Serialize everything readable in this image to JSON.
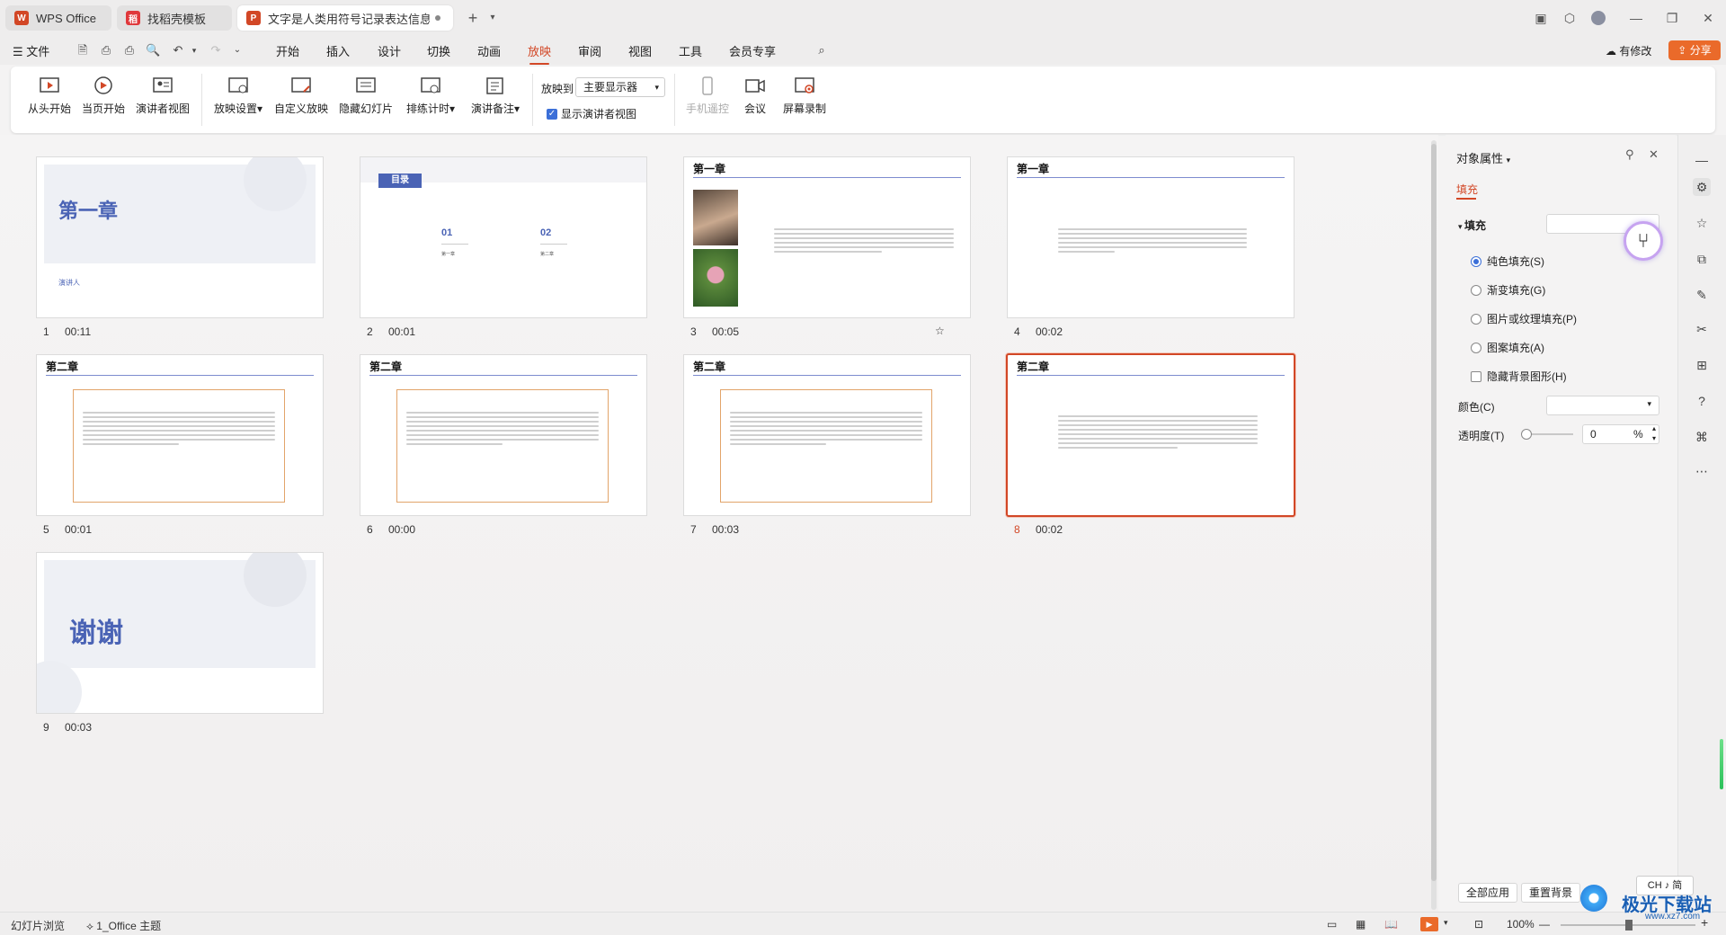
{
  "titlebar": {
    "tabs": [
      {
        "label": "WPS Office"
      },
      {
        "label": "找稻壳模板"
      },
      {
        "label": "文字是人类用符号记录表达信息以"
      }
    ],
    "new_tab": "+"
  },
  "menubar": {
    "file": "文件",
    "items": [
      "开始",
      "插入",
      "设计",
      "切换",
      "动画",
      "放映",
      "审阅",
      "视图",
      "工具",
      "会员专享"
    ],
    "active": "放映",
    "has_changes": "有修改",
    "share": "分享"
  },
  "ribbon": {
    "from_start": "从头开始",
    "from_current": "当页开始",
    "presenter_view": "演讲者视图",
    "show_settings": "放映设置",
    "custom_show": "自定义放映",
    "hide_slide": "隐藏幻灯片",
    "rehearse": "排练计时",
    "speaker_notes": "演讲备注",
    "play_to_label": "放映到",
    "play_to_value": "主要显示器",
    "show_presenter_view": "显示演讲者视图",
    "phone_remote": "手机遥控",
    "meeting": "会议",
    "screen_record": "屏幕录制"
  },
  "slides": [
    {
      "num": "1",
      "time": "00:11",
      "title": "第一章",
      "sub": "演讲人"
    },
    {
      "num": "2",
      "time": "00:01",
      "title": "目录",
      "items": [
        "01",
        "02"
      ],
      "subs": [
        "第一章",
        "第二章"
      ]
    },
    {
      "num": "3",
      "time": "00:05",
      "title": "第一章"
    },
    {
      "num": "4",
      "time": "00:02",
      "title": "第一章"
    },
    {
      "num": "5",
      "time": "00:01",
      "title": "第二章"
    },
    {
      "num": "6",
      "time": "00:00",
      "title": "第二章"
    },
    {
      "num": "7",
      "time": "00:03",
      "title": "第二章"
    },
    {
      "num": "8",
      "time": "00:02",
      "title": "第二章"
    },
    {
      "num": "9",
      "time": "00:03",
      "title": "谢谢"
    }
  ],
  "panel": {
    "title": "对象属性",
    "tab": "填充",
    "section": "填充",
    "options": [
      "纯色填充(S)",
      "渐变填充(G)",
      "图片或纹理填充(P)",
      "图案填充(A)"
    ],
    "hide_bg": "隐藏背景图形(H)",
    "color_label": "颜色(C)",
    "transparency_label": "透明度(T)",
    "transparency_value": "0",
    "transparency_unit": "%",
    "apply_all": "全部应用",
    "reset_bg": "重置背景"
  },
  "statusbar": {
    "view_mode": "幻灯片浏览",
    "theme": "1_Office 主题",
    "zoom": "100%",
    "ime": "CH ♪ 简"
  },
  "watermark": {
    "text": "极光下载站",
    "url": "www.xz7.com"
  },
  "colors": {
    "accent": "#d24726",
    "slide_blue": "#4a63b5",
    "frame_orange": "#e2a46a"
  }
}
